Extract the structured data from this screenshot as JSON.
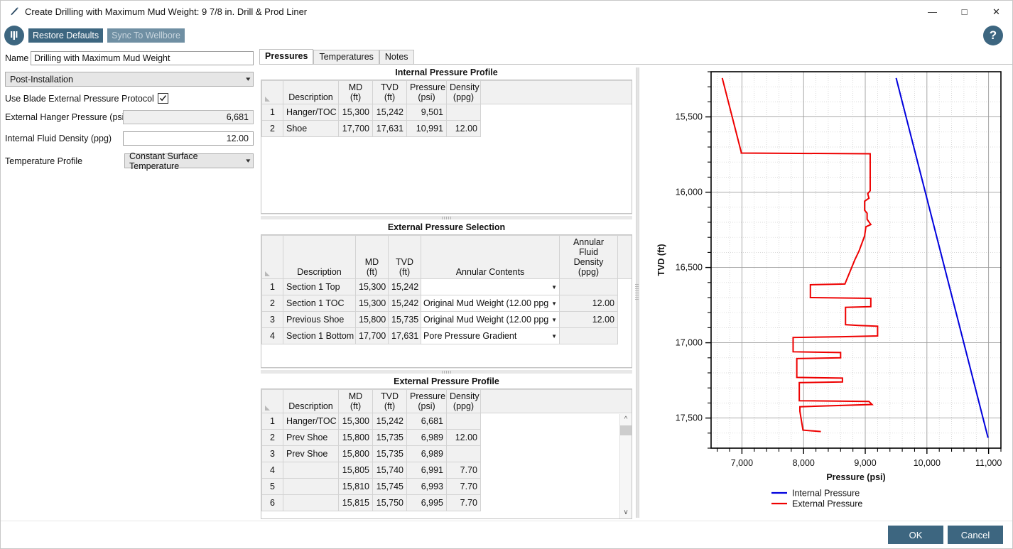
{
  "window": {
    "title": "Create Drilling with Maximum Mud Weight: 9 7/8 in. Drill & Prod Liner",
    "title_icon": "pencil-icon",
    "minimize": "—",
    "maximize": "□",
    "close": "✕"
  },
  "toolbar": {
    "logo": "blade-logo-icon",
    "restore_defaults": "Restore Defaults",
    "sync_to_wellbore": "Sync To Wellbore",
    "help": "?"
  },
  "left_panel": {
    "name_label": "Name",
    "name_value": "Drilling with Maximum Mud Weight",
    "stage_value": "Post-Installation",
    "protocol_label": "Use Blade External Pressure Protocol",
    "protocol_checked": true,
    "hanger_pressure_label": "External Hanger Pressure (psi)",
    "hanger_pressure_value": "6,681",
    "fluid_density_label": "Internal Fluid Density (ppg)",
    "fluid_density_value": "12.00",
    "temperature_profile_label": "Temperature Profile",
    "temperature_profile_value": "Constant Surface Temperature"
  },
  "tabs": [
    {
      "label": "Pressures",
      "active": true
    },
    {
      "label": "Temperatures",
      "active": false
    },
    {
      "label": "Notes",
      "active": false
    }
  ],
  "internal_pressure_profile": {
    "title": "Internal Pressure Profile",
    "columns": [
      "",
      "Description",
      "MD\n(ft)",
      "TVD\n(ft)",
      "Pressure\n(psi)",
      "Density\n(ppg)",
      ""
    ],
    "columns_flat": [
      "Description",
      "MD",
      "TVD",
      "Pressure",
      "Density"
    ],
    "units": [
      "",
      "(ft)",
      "(ft)",
      "(psi)",
      "(ppg)"
    ],
    "rows": [
      {
        "n": "1",
        "description": "Hanger/TOC",
        "md": "15,300",
        "tvd": "15,242",
        "pressure": "9,501",
        "density": ""
      },
      {
        "n": "2",
        "description": "Shoe",
        "md": "17,700",
        "tvd": "17,631",
        "pressure": "10,991",
        "density": "12.00"
      }
    ]
  },
  "external_pressure_selection": {
    "title": "External Pressure Selection",
    "columns_flat": [
      "Description",
      "MD",
      "TVD",
      "Annular Contents",
      "Annular Fluid"
    ],
    "units": [
      "",
      "(ft)",
      "(ft)",
      "",
      "Density (ppg)"
    ],
    "rows": [
      {
        "n": "1",
        "description": "Section 1 Top",
        "md": "15,300",
        "tvd": "15,242",
        "annular_contents": "",
        "annular_density": ""
      },
      {
        "n": "2",
        "description": "Section 1 TOC",
        "md": "15,300",
        "tvd": "15,242",
        "annular_contents": "Original Mud Weight (12.00 ppg)",
        "annular_density": "12.00"
      },
      {
        "n": "3",
        "description": "Previous Shoe",
        "md": "15,800",
        "tvd": "15,735",
        "annular_contents": "Original Mud Weight (12.00 ppg)",
        "annular_density": "12.00"
      },
      {
        "n": "4",
        "description": "Section 1 Bottom",
        "md": "17,700",
        "tvd": "17,631",
        "annular_contents": "Pore Pressure Gradient",
        "annular_density": ""
      }
    ]
  },
  "external_pressure_profile": {
    "title": "External Pressure Profile",
    "columns_flat": [
      "Description",
      "MD",
      "TVD",
      "Pressure",
      "Density"
    ],
    "units": [
      "",
      "(ft)",
      "(ft)",
      "(psi)",
      "(ppg)"
    ],
    "rows": [
      {
        "n": "1",
        "description": "Hanger/TOC",
        "md": "15,300",
        "tvd": "15,242",
        "pressure": "6,681",
        "density": ""
      },
      {
        "n": "2",
        "description": "Prev Shoe",
        "md": "15,800",
        "tvd": "15,735",
        "pressure": "6,989",
        "density": "12.00"
      },
      {
        "n": "3",
        "description": "Prev Shoe",
        "md": "15,800",
        "tvd": "15,735",
        "pressure": "6,989",
        "density": ""
      },
      {
        "n": "4",
        "description": "",
        "md": "15,805",
        "tvd": "15,740",
        "pressure": "6,991",
        "density": "7.70"
      },
      {
        "n": "5",
        "description": "",
        "md": "15,810",
        "tvd": "15,745",
        "pressure": "6,993",
        "density": "7.70"
      },
      {
        "n": "6",
        "description": "",
        "md": "15,815",
        "tvd": "15,750",
        "pressure": "6,995",
        "density": "7.70"
      }
    ]
  },
  "footer": {
    "ok": "OK",
    "cancel": "Cancel"
  },
  "colors": {
    "accent": "#3d6680",
    "internal": "#0000dd",
    "external": "#ee0000",
    "grid_major": "#9e9e9e",
    "grid_minor": "#cccccc"
  },
  "chart_data": {
    "type": "line",
    "title": "",
    "xlabel": "Pressure (psi)",
    "ylabel": "TVD (ft)",
    "xlim": [
      6500,
      11200
    ],
    "ylim": [
      17700,
      15200
    ],
    "y_inverted": true,
    "grid": true,
    "x_ticks": [
      7000,
      8000,
      9000,
      10000,
      11000
    ],
    "x_ticklabels": [
      "7,000",
      "8,000",
      "9,000",
      "10,000",
      "11,000"
    ],
    "y_ticks": [
      15500,
      16000,
      16500,
      17000,
      17500
    ],
    "y_ticklabels": [
      "15,500",
      "16,000",
      "16,500",
      "17,000",
      "17,500"
    ],
    "x_minor_step": 200,
    "y_minor_step": 100,
    "legend_position": "below",
    "series": [
      {
        "name": "Internal Pressure",
        "color": "#0000dd",
        "points": [
          [
            9501,
            15242
          ],
          [
            10991,
            17631
          ]
        ]
      },
      {
        "name": "External Pressure",
        "color": "#ee0000",
        "points": [
          [
            6681,
            15242
          ],
          [
            6989,
            15735
          ],
          [
            6989,
            15740
          ],
          [
            9080,
            15745
          ],
          [
            9080,
            15990
          ],
          [
            9040,
            16010
          ],
          [
            9060,
            16040
          ],
          [
            8990,
            16060
          ],
          [
            8990,
            16120
          ],
          [
            9030,
            16140
          ],
          [
            9030,
            16180
          ],
          [
            9090,
            16215
          ],
          [
            9010,
            16230
          ],
          [
            8990,
            16290
          ],
          [
            8900,
            16390
          ],
          [
            8830,
            16450
          ],
          [
            8670,
            16610
          ],
          [
            8110,
            16615
          ],
          [
            8110,
            16700
          ],
          [
            9090,
            16705
          ],
          [
            9090,
            16760
          ],
          [
            8680,
            16765
          ],
          [
            8680,
            16880
          ],
          [
            8890,
            16885
          ],
          [
            9200,
            16890
          ],
          [
            9200,
            16955
          ],
          [
            8620,
            16960
          ],
          [
            7830,
            16965
          ],
          [
            7830,
            17060
          ],
          [
            8600,
            17065
          ],
          [
            8600,
            17100
          ],
          [
            7890,
            17105
          ],
          [
            7890,
            17230
          ],
          [
            8630,
            17235
          ],
          [
            8630,
            17260
          ],
          [
            7930,
            17265
          ],
          [
            7930,
            17385
          ],
          [
            9060,
            17390
          ],
          [
            9110,
            17410
          ],
          [
            7940,
            17425
          ],
          [
            7940,
            17455
          ],
          [
            7990,
            17580
          ],
          [
            8280,
            17590
          ]
        ]
      }
    ]
  }
}
